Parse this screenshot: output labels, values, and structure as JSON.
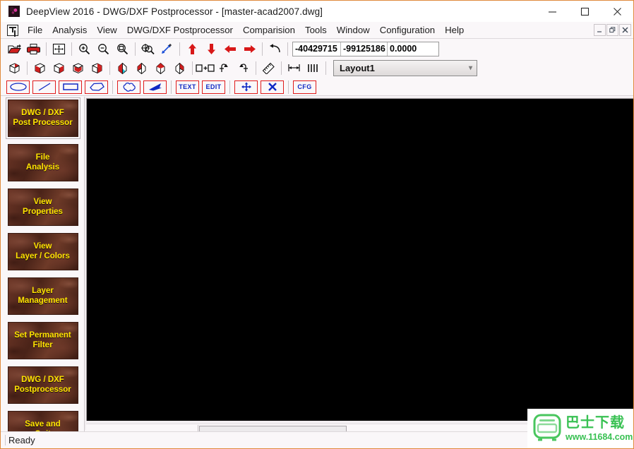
{
  "window": {
    "title": "DeepView 2016 - DWG/DXF Postprocessor - [master-acad2007.dwg]",
    "app_icon": "deepview-app-icon",
    "minimize_label": "Minimize",
    "maximize_label": "Maximize",
    "close_label": "Close"
  },
  "mdi": {
    "doc_icon": "document-icon",
    "restore_label": "Restore",
    "minimize_label": "Minimize",
    "close_label": "Close"
  },
  "menu": {
    "items": [
      {
        "label": "File"
      },
      {
        "label": "Analysis"
      },
      {
        "label": "View"
      },
      {
        "label": "DWG/DXF Postprocessor"
      },
      {
        "label": "Comparision"
      },
      {
        "label": "Tools"
      },
      {
        "label": "Window"
      },
      {
        "label": "Configuration"
      },
      {
        "label": "Help"
      }
    ]
  },
  "toolbar1": {
    "buttons": [
      {
        "name": "open-icon",
        "tip": "Open"
      },
      {
        "name": "print-icon",
        "tip": "Print"
      },
      {
        "name": "zoom-extents-icon",
        "tip": "Zoom Extents"
      },
      {
        "name": "zoom-in-icon",
        "tip": "Zoom In"
      },
      {
        "name": "zoom-out-icon",
        "tip": "Zoom Out"
      },
      {
        "name": "zoom-window-icon",
        "tip": "Zoom Window"
      },
      {
        "name": "zoom-pan-icon",
        "tip": "Pan / Zoom"
      },
      {
        "name": "zoom-scale-icon",
        "tip": "Zoom Scale"
      },
      {
        "name": "arrow-up-icon",
        "tip": "Pan Up"
      },
      {
        "name": "arrow-down-icon",
        "tip": "Pan Down"
      },
      {
        "name": "arrow-left-icon",
        "tip": "Pan Left"
      },
      {
        "name": "arrow-right-icon",
        "tip": "Pan Right"
      },
      {
        "name": "undo-icon",
        "tip": "Undo"
      }
    ],
    "coords": {
      "x_value": "-40429715",
      "y_value": "-99125186",
      "z_value": "0.0000"
    }
  },
  "toolbar2": {
    "buttons": [
      {
        "name": "view-iso-icon",
        "tip": "Isometric View"
      },
      {
        "name": "view-cube-front-icon",
        "tip": "Front View"
      },
      {
        "name": "view-cube-right-icon",
        "tip": "Right View"
      },
      {
        "name": "view-cube-top-icon",
        "tip": "Top View"
      },
      {
        "name": "view-cube-iso2-icon",
        "tip": "SE Isometric"
      },
      {
        "name": "view-diamond-1-icon",
        "tip": "View 1"
      },
      {
        "name": "view-diamond-2-icon",
        "tip": "View 2"
      },
      {
        "name": "view-diamond-3-icon",
        "tip": "View 3"
      },
      {
        "name": "view-diamond-4-icon",
        "tip": "View 4"
      },
      {
        "name": "tile-windows-icon",
        "tip": "Tile Windows"
      },
      {
        "name": "rotate-ccw-icon",
        "tip": "Rotate Counter-Clockwise"
      },
      {
        "name": "rotate-cw-icon",
        "tip": "Rotate Clockwise"
      },
      {
        "name": "measure-icon",
        "tip": "Measure"
      },
      {
        "name": "dimension-icon",
        "tip": "Dimension"
      },
      {
        "name": "layers-bars-icon",
        "tip": "Layers"
      }
    ],
    "layout_value": "Layout1",
    "layout_chevron": "chevron-down-icon"
  },
  "toolbar3": {
    "buttons": [
      {
        "name": "draw-ellipse-icon",
        "label": ""
      },
      {
        "name": "draw-line-icon",
        "label": ""
      },
      {
        "name": "draw-rectangle-icon",
        "label": ""
      },
      {
        "name": "draw-polygon-icon",
        "label": ""
      },
      {
        "name": "draw-cloud-icon",
        "label": ""
      },
      {
        "name": "draw-arrow-icon",
        "label": ""
      },
      {
        "name": "insert-text-button",
        "label": "TEXT"
      },
      {
        "name": "edit-button",
        "label": "EDIT"
      },
      {
        "name": "move-object-icon",
        "label": ""
      },
      {
        "name": "delete-object-icon",
        "label": ""
      },
      {
        "name": "config-button",
        "label": "CFG"
      }
    ]
  },
  "sidebar": {
    "items": [
      {
        "label": "DWG / DXF\nPost Processor",
        "name": "sidebar-item-dwg-dxf-post-processor",
        "active": true
      },
      {
        "label": "File\nAnalysis",
        "name": "sidebar-item-file-analysis",
        "active": false
      },
      {
        "label": "View\nProperties",
        "name": "sidebar-item-view-properties",
        "active": false
      },
      {
        "label": "View\nLayer / Colors",
        "name": "sidebar-item-view-layer-colors",
        "active": false
      },
      {
        "label": "Layer\nManagement",
        "name": "sidebar-item-layer-management",
        "active": false
      },
      {
        "label": "Set Permanent\nFilter",
        "name": "sidebar-item-set-permanent-filter",
        "active": false
      },
      {
        "label": "DWG / DXF\nPostprocessor",
        "name": "sidebar-item-dwg-dxf-postprocessor",
        "active": false
      },
      {
        "label": "Save and\nQuit",
        "name": "sidebar-item-save-and-quit",
        "active": false
      }
    ]
  },
  "canvas": {
    "background_color": "#000000",
    "hscroll_name": "horizontal-scrollbar"
  },
  "statusbar": {
    "text": "Ready"
  },
  "watermark": {
    "logo_name": "bus-download-logo",
    "cn_text": "巴士下载",
    "url_text": "www.11684.com",
    "color": "#39c153"
  },
  "colors": {
    "window_border": "#e08a3c",
    "sidebar_button_text": "#ffe400",
    "toolbar_red": "#e01b1b",
    "toolbar_blue": "#1029c4"
  }
}
